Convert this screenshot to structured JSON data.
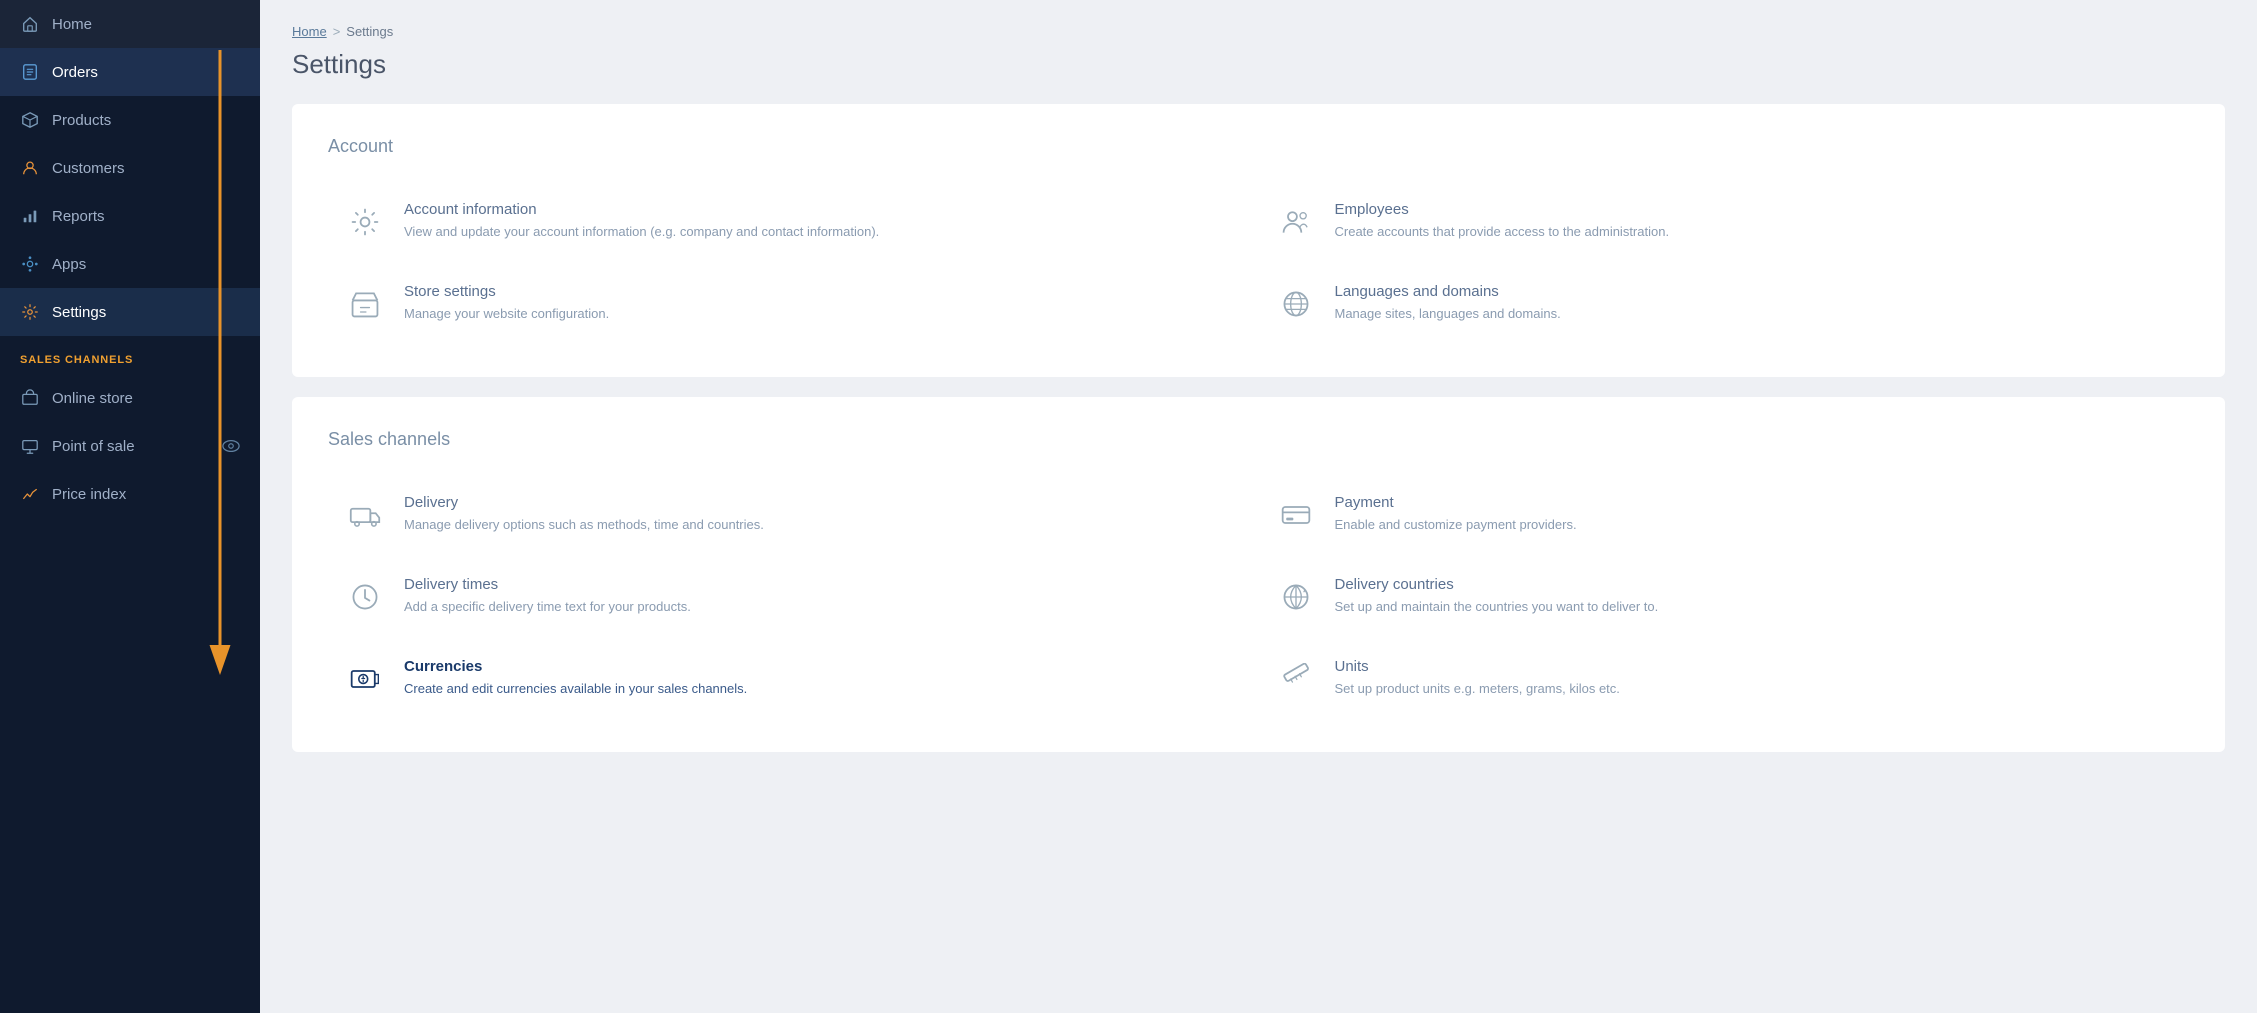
{
  "sidebar": {
    "items": [
      {
        "id": "home",
        "label": "Home",
        "icon": "home"
      },
      {
        "id": "orders",
        "label": "Orders",
        "icon": "orders",
        "active": true
      },
      {
        "id": "products",
        "label": "Products",
        "icon": "products"
      },
      {
        "id": "customers",
        "label": "Customers",
        "icon": "customers"
      },
      {
        "id": "reports",
        "label": "Reports",
        "icon": "reports"
      },
      {
        "id": "apps",
        "label": "Apps",
        "icon": "apps"
      },
      {
        "id": "settings",
        "label": "Settings",
        "icon": "settings",
        "active_settings": true
      }
    ],
    "sales_channels_header": "SALES CHANNELS",
    "sales_channels_items": [
      {
        "id": "online-store",
        "label": "Online store",
        "icon": "store"
      },
      {
        "id": "point-of-sale",
        "label": "Point of sale",
        "icon": "pos",
        "has_eye": true
      },
      {
        "id": "price-index",
        "label": "Price index",
        "icon": "price"
      }
    ]
  },
  "breadcrumb": {
    "home": "Home",
    "separator": ">",
    "current": "Settings"
  },
  "page": {
    "title": "Settings"
  },
  "account_section": {
    "title": "Account",
    "items": [
      {
        "id": "account-info",
        "title": "Account information",
        "description": "View and update your account information (e.g. company and contact information).",
        "icon": "gear"
      },
      {
        "id": "employees",
        "title": "Employees",
        "description": "Create accounts that provide access to the administration.",
        "icon": "employees"
      },
      {
        "id": "store-settings",
        "title": "Store settings",
        "description": "Manage your website configuration.",
        "icon": "store-settings"
      },
      {
        "id": "languages-domains",
        "title": "Languages and domains",
        "description": "Manage sites, languages and domains.",
        "icon": "globe"
      }
    ]
  },
  "sales_channels_section": {
    "title": "Sales channels",
    "items": [
      {
        "id": "delivery",
        "title": "Delivery",
        "description": "Manage delivery options such as methods, time and countries.",
        "icon": "delivery"
      },
      {
        "id": "payment",
        "title": "Payment",
        "description": "Enable and customize payment providers.",
        "icon": "payment"
      },
      {
        "id": "delivery-times",
        "title": "Delivery times",
        "description": "Add a specific delivery time text for your products.",
        "icon": "clock"
      },
      {
        "id": "delivery-countries",
        "title": "Delivery countries",
        "description": "Set up and maintain the countries you want to deliver to.",
        "icon": "globe-delivery"
      },
      {
        "id": "currencies",
        "title": "Currencies",
        "description": "Create and edit currencies available in your sales channels.",
        "icon": "currencies",
        "highlighted": true
      },
      {
        "id": "units",
        "title": "Units",
        "description": "Set up product units e.g. meters, grams, kilos etc.",
        "icon": "ruler"
      }
    ]
  }
}
